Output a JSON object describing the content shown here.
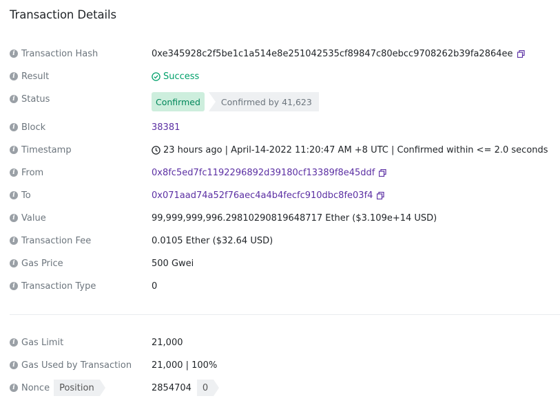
{
  "title": "Transaction Details",
  "rows": {
    "tx_hash": {
      "label": "Transaction Hash",
      "value": "0xe345928c2f5be1c1a514e8e251042535cf89847c80ebcc9708262b39fa2864ee"
    },
    "result": {
      "label": "Result",
      "value": "Success"
    },
    "status": {
      "label": "Status",
      "badge": "Confirmed",
      "confirmations": "Confirmed by 41,623"
    },
    "block": {
      "label": "Block",
      "value": "38381"
    },
    "timestamp": {
      "label": "Timestamp",
      "value": "23 hours ago | April-14-2022 11:20:47 AM +8 UTC | Confirmed within <= 2.0 seconds"
    },
    "from": {
      "label": "From",
      "value": "0x8fc5ed7fc1192296892d39180cf13389f8e45ddf"
    },
    "to": {
      "label": "To",
      "value": "0x071aad74a52f76aec4a4b4fecfc910dbc8fe03f4"
    },
    "value": {
      "label": "Value",
      "value": "99,999,999,996.29810290819648717 Ether ($3.109e+14 USD)"
    },
    "fee": {
      "label": "Transaction Fee",
      "value": "0.0105 Ether ($32.64 USD)"
    },
    "gas_price": {
      "label": "Gas Price",
      "value": "500 Gwei"
    },
    "tx_type": {
      "label": "Transaction Type",
      "value": "0"
    },
    "gas_limit": {
      "label": "Gas Limit",
      "value": "21,000"
    },
    "gas_used": {
      "label": "Gas Used by Transaction",
      "value": "21,000 | 100%"
    },
    "nonce": {
      "label": "Nonce",
      "tag": "Position",
      "value": "2854704",
      "position": "0"
    }
  },
  "colors": {
    "link": "#5b2fa3",
    "success": "#00a06a",
    "badge_bg": "#cdeedd",
    "label": "#6c757d"
  },
  "icons": {
    "info": "info-circle-icon",
    "copy": "copy-icon",
    "check": "check-circle-icon",
    "clock": "clock-icon"
  }
}
